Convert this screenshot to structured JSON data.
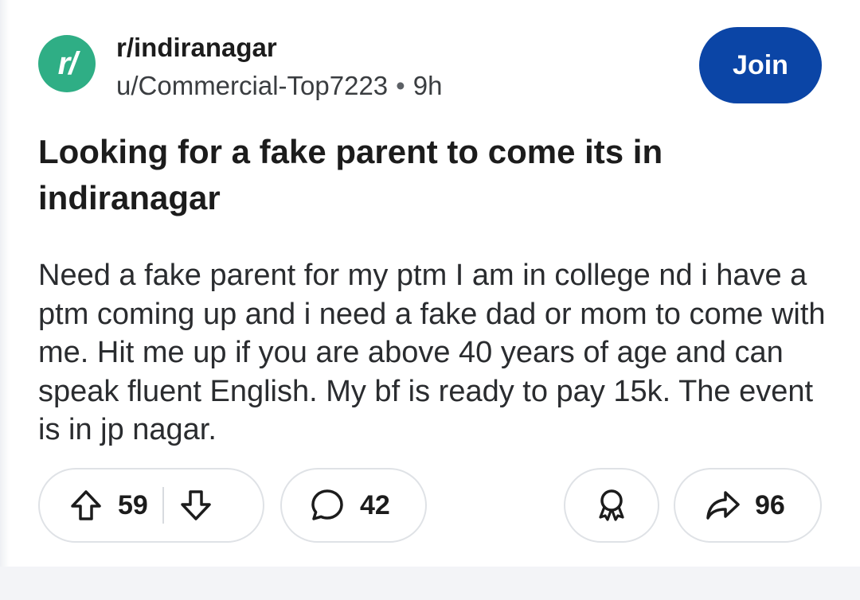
{
  "post": {
    "subreddit": "r/indiranagar",
    "subreddit_icon_text": "r/",
    "author": "u/Commercial-Top7223",
    "separator": "•",
    "age": "9h",
    "join_label": "Join",
    "title": "Looking for a fake parent to come its in indiranagar",
    "body": "Need a fake parent for my ptm I am in college nd i have a ptm coming up and i need a fake dad or mom to come with me. Hit me up if you are above 40 years of age and can speak fluent English. My bf is ready to pay 15k. The event is in jp nagar."
  },
  "actions": {
    "upvote_count": "59",
    "comment_count": "42",
    "share_count": "96",
    "icons": {
      "upvote": "upvote-arrow-icon",
      "downvote": "downvote-arrow-icon",
      "comment": "comment-bubble-icon",
      "award": "award-ribbon-icon",
      "share": "share-arrow-icon"
    }
  },
  "colors": {
    "join_button": "#0b45a6",
    "subreddit_icon": "#2fae85",
    "pill_border": "#dfe2e6"
  }
}
